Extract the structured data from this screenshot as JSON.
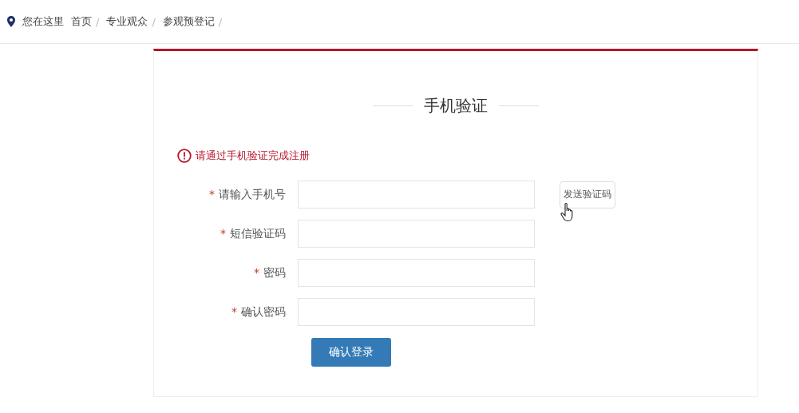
{
  "breadcrumb": {
    "label": "您在这里",
    "items": [
      "首页",
      "专业观众",
      "参观预登记"
    ],
    "separator": "/"
  },
  "form": {
    "title": "手机验证",
    "notice": "请通过手机验证完成注册",
    "fields": [
      {
        "label": "请输入手机号",
        "required_mark": "*",
        "button": "发送验证码"
      },
      {
        "label": "短信验证码",
        "required_mark": "*"
      },
      {
        "label": "密码",
        "required_mark": "*"
      },
      {
        "label": "确认密码",
        "required_mark": "*"
      }
    ],
    "submit": "确认登录"
  }
}
